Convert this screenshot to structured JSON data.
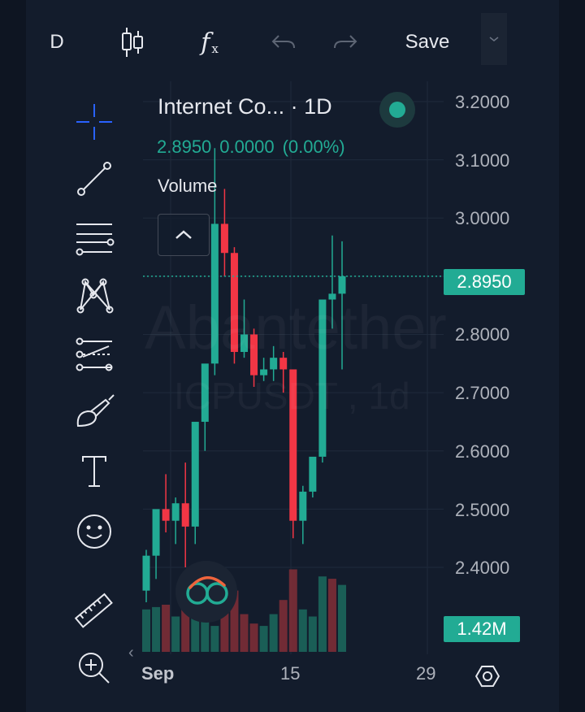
{
  "toolbar": {
    "resolution": "D",
    "indicators_icon": "candles-icon",
    "fx_label": "f",
    "fx_sub": "x",
    "undo_icon": "undo-icon",
    "redo_icon": "redo-icon",
    "save_label": "Save",
    "more_icon": "chevron-down-icon"
  },
  "tools": [
    {
      "name": "crosshair-tool",
      "icon": "crosshair-icon"
    },
    {
      "name": "trend-line-tool",
      "icon": "trend-line-icon"
    },
    {
      "name": "fib-tool",
      "icon": "fib-retracement-icon"
    },
    {
      "name": "pattern-tool",
      "icon": "pattern-icon"
    },
    {
      "name": "projection-tool",
      "icon": "projection-icon"
    },
    {
      "name": "brush-tool",
      "icon": "brush-icon"
    },
    {
      "name": "text-tool",
      "icon": "text-icon"
    },
    {
      "name": "emoji-tool",
      "icon": "smiley-icon"
    },
    {
      "name": "ruler-tool",
      "icon": "ruler-icon"
    },
    {
      "name": "zoom-tool",
      "icon": "zoom-in-icon"
    }
  ],
  "legend": {
    "title": "Internet Co... · 1D",
    "price": "2.8950",
    "change": "0.0000",
    "change_pct": "(0.00%)",
    "volume_label": "Volume"
  },
  "watermark": {
    "line1": "Abantether",
    "line2": "ICPUSDT , 1d"
  },
  "price_axis": {
    "ticks": [
      "3.2000",
      "3.1000",
      "3.0000",
      "2.8000",
      "2.7000",
      "2.6000",
      "2.5000",
      "2.4000"
    ],
    "current_price": "2.8950",
    "volume_value": "1.42M"
  },
  "time_axis": {
    "labels": [
      "Sep",
      "15",
      "29"
    ]
  },
  "colors": {
    "up": "#22ab94",
    "down": "#f23645",
    "background": "#131c2c",
    "accent": "#2962ff"
  },
  "chart_data": {
    "type": "candlestick",
    "candles": [
      {
        "o": 2.36,
        "h": 2.43,
        "l": 2.34,
        "c": 2.42
      },
      {
        "o": 2.42,
        "h": 2.47,
        "l": 2.38,
        "c": 2.5
      },
      {
        "o": 2.5,
        "h": 2.56,
        "l": 2.46,
        "c": 2.48
      },
      {
        "o": 2.48,
        "h": 2.52,
        "l": 2.44,
        "c": 2.51
      },
      {
        "o": 2.51,
        "h": 2.58,
        "l": 2.4,
        "c": 2.47
      },
      {
        "o": 2.47,
        "h": 2.52,
        "l": 2.44,
        "c": 2.65
      },
      {
        "o": 2.65,
        "h": 2.74,
        "l": 2.6,
        "c": 2.75
      },
      {
        "o": 2.75,
        "h": 3.12,
        "l": 2.73,
        "c": 2.99
      },
      {
        "o": 2.99,
        "h": 3.05,
        "l": 2.9,
        "c": 2.94
      },
      {
        "o": 2.94,
        "h": 2.95,
        "l": 2.75,
        "c": 2.77
      },
      {
        "o": 2.77,
        "h": 2.86,
        "l": 2.76,
        "c": 2.8
      },
      {
        "o": 2.8,
        "h": 2.81,
        "l": 2.71,
        "c": 2.73
      },
      {
        "o": 2.73,
        "h": 2.76,
        "l": 2.72,
        "c": 2.74
      },
      {
        "o": 2.74,
        "h": 2.78,
        "l": 2.72,
        "c": 2.76
      },
      {
        "o": 2.76,
        "h": 2.77,
        "l": 2.7,
        "c": 2.74
      },
      {
        "o": 2.74,
        "h": 2.74,
        "l": 2.45,
        "c": 2.48
      },
      {
        "o": 2.48,
        "h": 2.54,
        "l": 2.44,
        "c": 2.53
      },
      {
        "o": 2.53,
        "h": 2.56,
        "l": 2.52,
        "c": 2.59
      },
      {
        "o": 2.59,
        "h": 2.59,
        "l": 2.58,
        "c": 2.86
      },
      {
        "o": 2.86,
        "h": 2.97,
        "l": 2.81,
        "c": 2.87
      },
      {
        "o": 2.87,
        "h": 2.96,
        "l": 2.74,
        "c": 2.9
      }
    ],
    "volumes": [
      0.9,
      0.95,
      1.0,
      0.75,
      1.6,
      1.1,
      1.2,
      0.55,
      0.9,
      1.3,
      0.8,
      0.6,
      0.55,
      0.8,
      1.1,
      1.75,
      0.9,
      0.75,
      1.6,
      1.55,
      1.42
    ],
    "volume_dirs": [
      "up",
      "up",
      "down",
      "up",
      "down",
      "up",
      "up",
      "up",
      "down",
      "down",
      "down",
      "down",
      "up",
      "up",
      "down",
      "down",
      "up",
      "up",
      "up",
      "down",
      "up"
    ],
    "ylim": [
      2.34,
      3.22
    ],
    "volume_current": "1.42M"
  }
}
